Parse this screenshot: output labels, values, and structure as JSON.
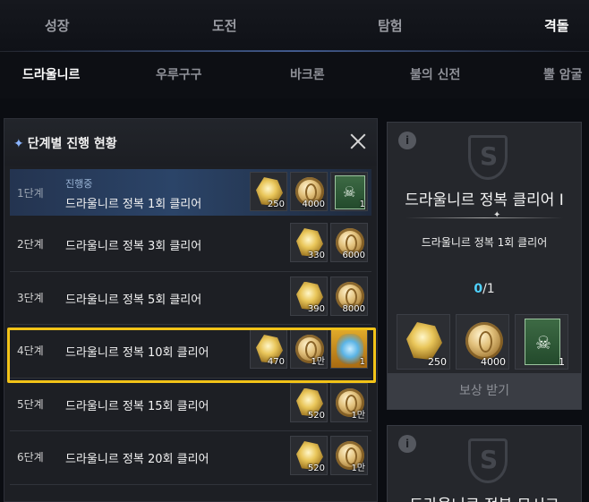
{
  "top_tabs": [
    {
      "label": "성장"
    },
    {
      "label": "도전"
    },
    {
      "label": "탐험"
    },
    {
      "label": "격돌"
    }
  ],
  "sub_tabs": [
    {
      "label": "드라울니르"
    },
    {
      "label": "우루구구"
    },
    {
      "label": "바크론"
    },
    {
      "label": "불의 신전"
    },
    {
      "label": "뿔 암굴"
    }
  ],
  "panel": {
    "title": "단계별 진행 현황",
    "rows": [
      {
        "stage": "1단계",
        "status": "진행중",
        "label": "드라울니르 정복 1회 클리어",
        "rewards": [
          {
            "icon": "crystal-icon",
            "qty": "250"
          },
          {
            "icon": "coin-icon",
            "qty": "4000"
          },
          {
            "icon": "card-icon",
            "qty": "1"
          }
        ]
      },
      {
        "stage": "2단계",
        "label": "드라울니르 정복 3회 클리어",
        "rewards": [
          {
            "icon": "crystal-icon",
            "qty": "330"
          },
          {
            "icon": "coin-icon",
            "qty": "6000"
          }
        ]
      },
      {
        "stage": "3단계",
        "label": "드라울니르 정복 5회 클리어",
        "rewards": [
          {
            "icon": "crystal-icon",
            "qty": "390"
          },
          {
            "icon": "coin-icon",
            "qty": "8000"
          }
        ]
      },
      {
        "stage": "4단계",
        "label": "드라울니르 정복 10회 클리어",
        "rewards": [
          {
            "icon": "crystal-icon",
            "qty": "470"
          },
          {
            "icon": "coin-icon",
            "qty": "1만"
          },
          {
            "icon": "blue-card-icon",
            "qty": "1"
          }
        ]
      },
      {
        "stage": "5단계",
        "label": "드라울니르 정복 15회 클리어",
        "rewards": [
          {
            "icon": "crystal-icon",
            "qty": "520"
          },
          {
            "icon": "coin-icon",
            "qty": "1만"
          }
        ]
      },
      {
        "stage": "6단계",
        "label": "드라울니르 정복 20회 클리어",
        "rewards": [
          {
            "icon": "crystal-icon",
            "qty": "520"
          },
          {
            "icon": "coin-icon",
            "qty": "1만"
          }
        ]
      }
    ]
  },
  "detail": {
    "title": "드라울니르 정복 클리어 Ⅰ",
    "subtitle": "드라울니르 정복 1회 클리어",
    "progress_current": "0",
    "progress_total": "/1",
    "rewards": [
      {
        "icon": "crystal-icon",
        "qty": "250"
      },
      {
        "icon": "coin-icon",
        "qty": "4000"
      },
      {
        "icon": "card-icon",
        "qty": "1"
      }
    ],
    "claim_label": "보상 받기"
  },
  "detail2": {
    "title": "드라울니르 정복 모시고"
  },
  "colors": {
    "highlight": "#f2c318",
    "accent": "#4fd2ff"
  }
}
